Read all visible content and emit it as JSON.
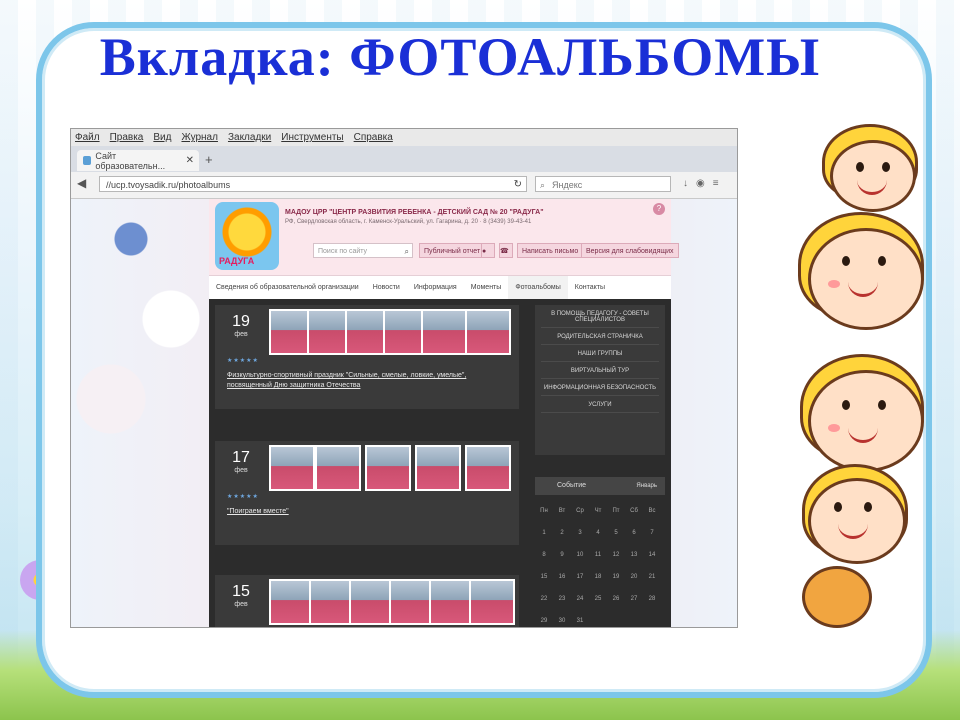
{
  "slide": {
    "title": "Вкладка: ФОТОАЛЬБОМЫ"
  },
  "browser": {
    "menu": [
      "Файл",
      "Правка",
      "Вид",
      "Журнал",
      "Закладки",
      "Инструменты",
      "Справка"
    ],
    "tab_title": "Сайт образовательн...",
    "url": "//ucp.tvoysadik.ru/photoalbums",
    "search_placeholder": "Яндекс"
  },
  "site": {
    "org_name": "МАДОУ ЦРР \"ЦЕНТР РАЗВИТИЯ РЕБЕНКА - ДЕТСКИЙ САД № 20 \"РАДУГА\"",
    "address": "РФ, Свердловская область, г. Каменск-Уральский, ул. Гагарина, д. 20 · 8 (3439) 39-43-41",
    "logo_text": "РАДУГА",
    "search_placeholder": "Поиск по сайту",
    "buttons": [
      "Публичный отчет",
      "Написать письмо",
      "Версия для слабовидящих"
    ],
    "nav": [
      "Сведения об образовательной организации",
      "Новости",
      "Информация",
      "Моменты",
      "Фотоальбомы",
      "Контакты"
    ],
    "nav_active": "Фотоальбомы",
    "albums": [
      {
        "day": "19",
        "month": "фев",
        "title": "Физкультурно-спортивный праздник \"Сильные, смелые, ловкие, умелые\", посвященный Дню защитника Отечества"
      },
      {
        "day": "17",
        "month": "фев",
        "title": "\"Поиграем вместе\""
      },
      {
        "day": "15",
        "month": "фев",
        "title": ""
      }
    ],
    "sidebar": [
      "В ПОМОЩЬ ПЕДАГОГУ - СОВЕТЫ СПЕЦИАЛИСТОВ",
      "РОДИТЕЛЬСКАЯ СТРАНИЧКА",
      "НАШИ ГРУППЫ",
      "ВИРТУАЛЬНЫЙ ТУР",
      "ИНФОРМАЦИОННАЯ БЕЗОПАСНОСТЬ",
      "УСЛУГИ"
    ],
    "calendar": {
      "month": "Событие",
      "next": "Январь",
      "weekdays": [
        "Пн",
        "Вт",
        "Ср",
        "Чт",
        "Пт",
        "Сб",
        "Вс"
      ],
      "days": [
        "1",
        "2",
        "3",
        "4",
        "5",
        "6",
        "7",
        "8",
        "9",
        "10",
        "11",
        "12",
        "13",
        "14",
        "15",
        "16",
        "17",
        "18",
        "19",
        "20",
        "21",
        "22",
        "23",
        "24",
        "25",
        "26",
        "27",
        "28",
        "29",
        "30",
        "31"
      ]
    }
  },
  "colors": {
    "title": "#1a2fd6",
    "frame": "#7cc6ea",
    "site_dark": "#2c2c2c"
  }
}
